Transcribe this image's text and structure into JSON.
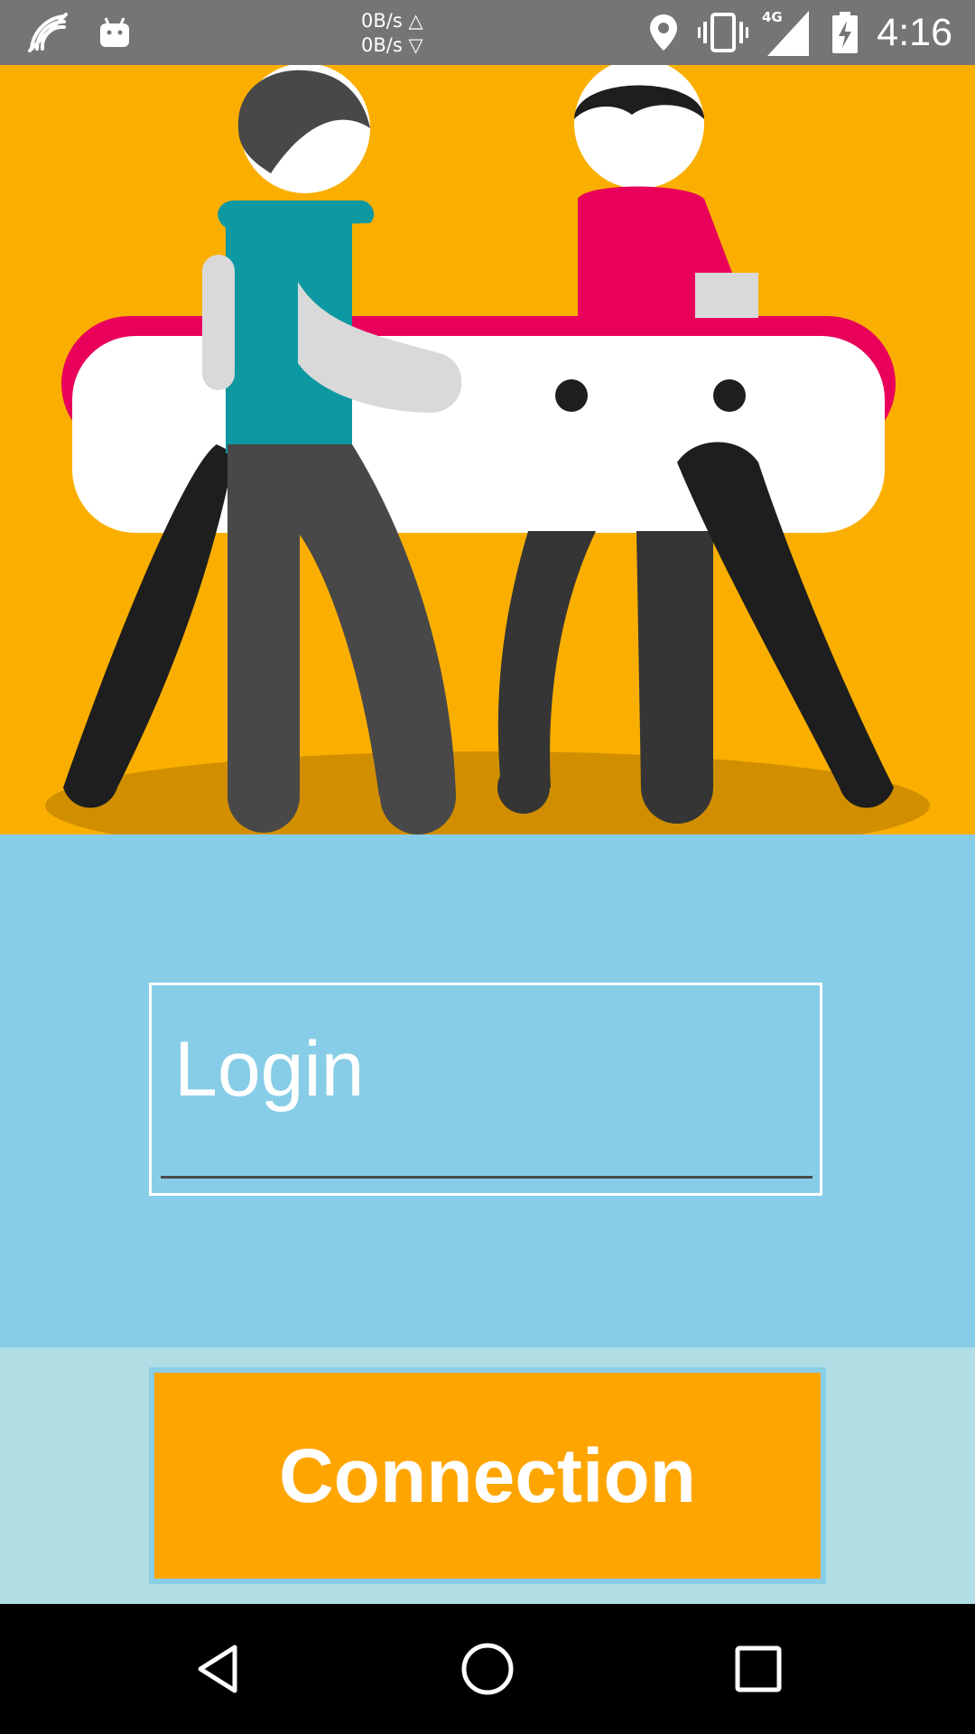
{
  "status_bar": {
    "net_up": "0B/s △",
    "net_down": "0B/s ▽",
    "network": "4G",
    "time": "4:16",
    "icons": [
      "wifi-off-icon",
      "android-icon",
      "location-icon",
      "vibrate-icon",
      "signal-icon",
      "battery-charging-icon"
    ]
  },
  "hero": {
    "description_icon": "pommel-horse-illustration",
    "background_color": "#FAAF00"
  },
  "login": {
    "placeholder": "Login",
    "value": ""
  },
  "actions": {
    "connection_label": "Connection"
  },
  "colors": {
    "login_area": "#87CDE8",
    "bottom_area": "#B0DEE4",
    "button": "#FFA500"
  },
  "navigation": {
    "buttons": [
      "back-icon",
      "home-icon",
      "recents-icon"
    ]
  }
}
